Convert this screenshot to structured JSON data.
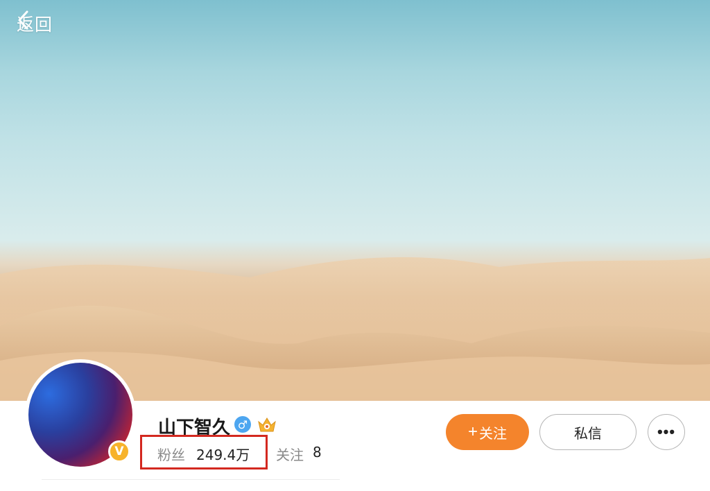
{
  "header": {
    "back_label": "返回",
    "back_icon": "chevron-left-icon"
  },
  "cover": {
    "description_colors": {
      "sky": "#bfe1e6",
      "sand": "#e2c29c"
    }
  },
  "profile": {
    "name": "山下智久",
    "gender_icon": "male-icon",
    "gender_symbol": "♂",
    "vip_icon": "crown-badge-icon",
    "verified_badge_text": "V",
    "fans_label": "粉丝",
    "fans_count": "249.4万",
    "following_label": "关注",
    "following_count": "8"
  },
  "actions": {
    "follow_label": "关注",
    "follow_plus": "+",
    "message_label": "私信",
    "more_label": "•••"
  },
  "colors": {
    "accent": "#f4842c",
    "highlight_box": "#d3281f",
    "verified": "#f7b32b",
    "gender": "#4da6f0"
  }
}
